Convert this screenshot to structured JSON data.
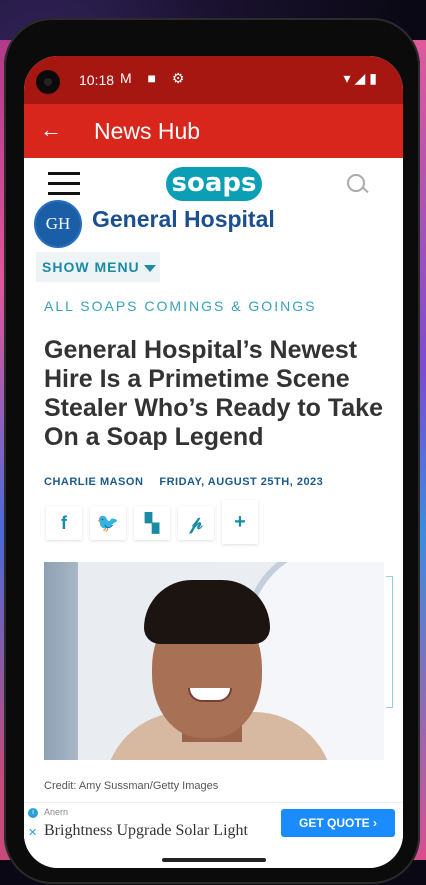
{
  "status_bar": {
    "time": "10:18",
    "left_icons": "M ■ ⚙",
    "right_icons": "▾◢▮"
  },
  "app_bar": {
    "back_icon": "←",
    "title": "News Hub"
  },
  "site_header": {
    "logo_text": "soaps"
  },
  "show": {
    "badge": "GH",
    "title": "General Hospital"
  },
  "menu": {
    "label": "SHOW MENU"
  },
  "article": {
    "category": "ALL SOAPS COMINGS & GOINGS",
    "headline": "General Hospital’s Newest Hire Is a Primetime Scene Stealer Who’s Ready to Take On a Soap Legend",
    "author": "CHARLIE MASON",
    "date": "FRIDAY, AUGUST 25TH, 2023",
    "photo_credit": "Credit: Amy Sussman/Getty Images"
  },
  "share_buttons": {
    "facebook": "f",
    "twitter": "🐦",
    "flipboard": "▚",
    "pinterest": "𝓅",
    "more": "+"
  },
  "ad": {
    "advertiser": "Anern",
    "text": "Brightness Upgrade Solar Light",
    "cta": "GET QUOTE ›",
    "info_icon": "i",
    "close_icon": "✕"
  },
  "colors": {
    "status_bar": "#a61712",
    "app_bar": "#d8261d",
    "logo": "#0b9fb5",
    "accent": "#1b8aa3",
    "cta": "#1a8cff"
  }
}
